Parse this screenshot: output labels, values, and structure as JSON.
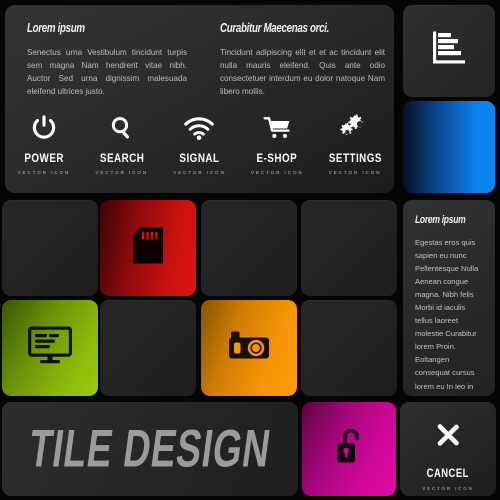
{
  "header": {
    "columns": [
      {
        "title": "Lorem ipsum",
        "body": "Senectus urna Vestibulum tincidunt turpis sem magna Nam hendrerit vitae nibh. Auctor Sed urna dignissim malesuada eleifend ultrices justo."
      },
      {
        "title": "Curabitur Maecenas orci.",
        "body": "Tincidunt adipiscing elit et et ac tincidunt elit nulla mauris eleifend. Quis ante odio consectetuer interdum eu dolor natoque Nam libero mollis."
      }
    ],
    "icons": [
      {
        "icon": "power-icon",
        "label": "POWER",
        "sublabel": "VECTOR ICON"
      },
      {
        "icon": "search-icon",
        "label": "SEARCH",
        "sublabel": "VECTOR ICON"
      },
      {
        "icon": "wifi-icon",
        "label": "SIGNAL",
        "sublabel": "VECTOR ICON"
      },
      {
        "icon": "cart-icon",
        "label": "E-SHOP",
        "sublabel": "VECTOR ICON"
      },
      {
        "icon": "gears-icon",
        "label": "SETTINGS",
        "sublabel": "VECTOR ICON"
      }
    ]
  },
  "sidebar": {
    "chart_tile": {
      "icon": "bar-chart-icon"
    },
    "blue_tile": {
      "color": "#0a88f4"
    },
    "text_tile": {
      "title": "Lorem ipsum",
      "body": "Egestas eros quis sapien eu nunc Pellentesque Nulla Aenean congue magna. Nibh felis Morbi id iaculis tellus laoreet molestie Curabitur lorem Proin. Eoltangen consequat cursus lorem eu In leo in diam tortor."
    }
  },
  "grid": {
    "tiles": [
      {
        "icon": "",
        "color": "#2a2a2a"
      },
      {
        "icon": "sd-card-icon",
        "color": "#d0110f"
      },
      {
        "icon": "",
        "color": "#2a2a2a"
      },
      {
        "icon": "",
        "color": "#2a2a2a"
      },
      {
        "icon": "monitor-icon",
        "color": "#8fba0c"
      },
      {
        "icon": "",
        "color": "#2a2a2a"
      },
      {
        "icon": "camera-icon",
        "color": "#f79407"
      },
      {
        "icon": "",
        "color": "#2a2a2a"
      }
    ]
  },
  "footer": {
    "brand": "TILE DESIGN",
    "lock_tile": {
      "icon": "unlocked-padlock-icon",
      "color": "#cf0897"
    },
    "cancel_tile": {
      "icon": "close-x-icon",
      "label": "CANCEL",
      "sublabel": "VECTOR ICON"
    }
  }
}
